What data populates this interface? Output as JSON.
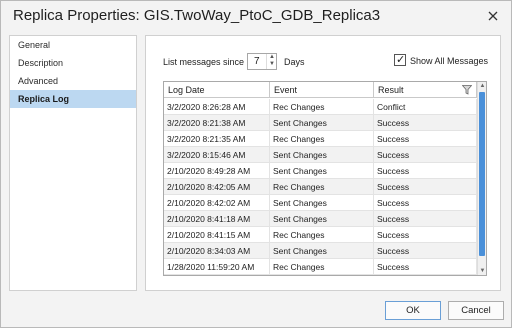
{
  "window": {
    "title": "Replica Properties: GIS.TwoWay_PtoC_GDB_Replica3",
    "close_icon": "close-icon"
  },
  "nav": {
    "items": [
      {
        "label": "General",
        "active": false
      },
      {
        "label": "Description",
        "active": false
      },
      {
        "label": "Advanced",
        "active": false
      },
      {
        "label": "Replica Log",
        "active": true
      }
    ]
  },
  "log": {
    "since_label": "List messages since",
    "days_value": "7",
    "days_label": "Days",
    "show_all_label": "Show All Messages",
    "show_all_checked": true,
    "columns": [
      "Log Date",
      "Event",
      "Result"
    ],
    "rows": [
      [
        "3/2/2020 8:26:28 AM",
        "Rec Changes",
        "Conflict"
      ],
      [
        "3/2/2020 8:21:38 AM",
        "Sent Changes",
        "Success"
      ],
      [
        "3/2/2020 8:21:35 AM",
        "Rec Changes",
        "Success"
      ],
      [
        "3/2/2020 8:15:46 AM",
        "Sent Changes",
        "Success"
      ],
      [
        "2/10/2020 8:49:28 AM",
        "Sent Changes",
        "Success"
      ],
      [
        "2/10/2020 8:42:05 AM",
        "Rec Changes",
        "Success"
      ],
      [
        "2/10/2020 8:42:02 AM",
        "Sent Changes",
        "Success"
      ],
      [
        "2/10/2020 8:41:18 AM",
        "Sent Changes",
        "Success"
      ],
      [
        "2/10/2020 8:41:15 AM",
        "Rec Changes",
        "Success"
      ],
      [
        "2/10/2020 8:34:03 AM",
        "Sent Changes",
        "Success"
      ],
      [
        "1/28/2020 11:59:20 AM",
        "Rec Changes",
        "Success"
      ]
    ]
  },
  "buttons": {
    "ok": "OK",
    "cancel": "Cancel"
  },
  "colors": {
    "selection": "#bcd8f1",
    "scroll_thumb": "#4a90d9"
  }
}
